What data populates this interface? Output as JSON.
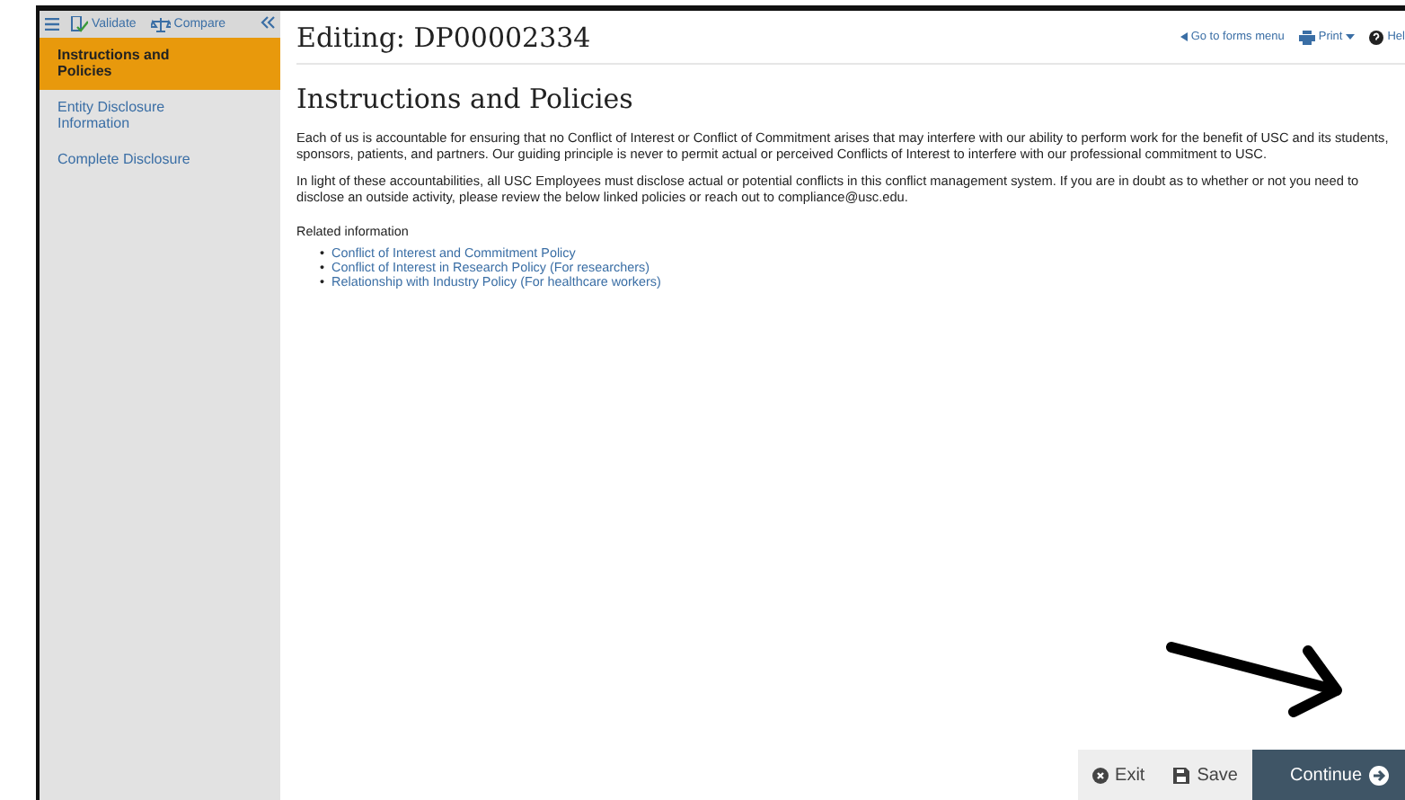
{
  "toolbar": {
    "validate": "Validate",
    "compare": "Compare"
  },
  "sidebar": {
    "items": [
      {
        "label": "Instructions and Policies",
        "selected": true
      },
      {
        "label": "Entity Disclosure Information",
        "selected": false
      },
      {
        "label": "Complete Disclosure",
        "selected": false
      }
    ]
  },
  "header": {
    "title": "Editing: DP00002334",
    "links": [
      "Go to forms menu",
      "Print",
      "Hel"
    ]
  },
  "page": {
    "heading": "Instructions and Policies",
    "paragraphs": [
      "Each of us is accountable for ensuring that no Conflict of Interest or Conflict of Commitment arises that may interfere with our ability to perform work for the benefit of USC and its students, sponsors, patients, and partners. Our guiding principle is never to permit actual or perceived Conflicts of Interest to interfere with our professional commitment to USC.",
      "In light of these accountabilities, all USC Employees must disclose actual or potential conflicts in this conflict management system. If you are in doubt as to whether or not you need to disclose an outside activity, please review the below linked policies or reach out to compliance@usc.edu."
    ],
    "related_label": "Related information",
    "related_links": [
      {
        "bullet": "•",
        "label": "Conflict of Interest and Commitment Policy"
      },
      {
        "bullet": "•",
        "label": "Conflict of Interest in Research Policy (For researchers)"
      },
      {
        "bullet": "•",
        "label": "Relationship with Industry Policy (For healthcare workers)"
      }
    ]
  },
  "footer": {
    "buttons": [
      "Exit",
      "Save",
      "Continue"
    ]
  }
}
